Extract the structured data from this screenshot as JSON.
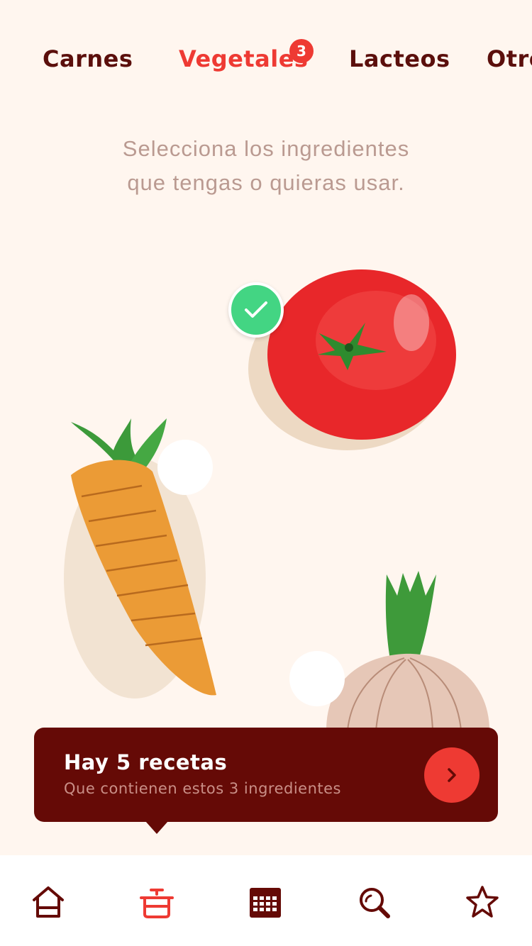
{
  "tabs": [
    {
      "label": "Carnes",
      "active": false
    },
    {
      "label": "Vegetales",
      "active": true,
      "badge": "3"
    },
    {
      "label": "Lacteos",
      "active": false
    },
    {
      "label": "Otros",
      "active": false
    }
  ],
  "instructions": {
    "line1": "Selecciona los ingredientes",
    "line2": "que tengas o quieras usar."
  },
  "ingredients": [
    {
      "name": "tomato-illustration",
      "selected": true
    },
    {
      "name": "carrot-illustration",
      "selected": false
    },
    {
      "name": "onion-illustration",
      "selected": false
    }
  ],
  "banner": {
    "title": "Hay 5 recetas",
    "subtitle": "Que contienen estos 3 ingredientes",
    "action_icon": "chevron-right-icon"
  },
  "bottom_nav": [
    {
      "icon": "home-icon",
      "active": false
    },
    {
      "icon": "pot-icon",
      "active": true
    },
    {
      "icon": "calendar-icon",
      "active": false
    },
    {
      "icon": "search-icon",
      "active": false
    },
    {
      "icon": "star-icon",
      "active": false
    }
  ],
  "colors": {
    "background": "#FFF6EF",
    "accent": "#EE3A33",
    "dark": "#5B0F0C",
    "banner": "#650A06",
    "selected": "#43D583"
  }
}
